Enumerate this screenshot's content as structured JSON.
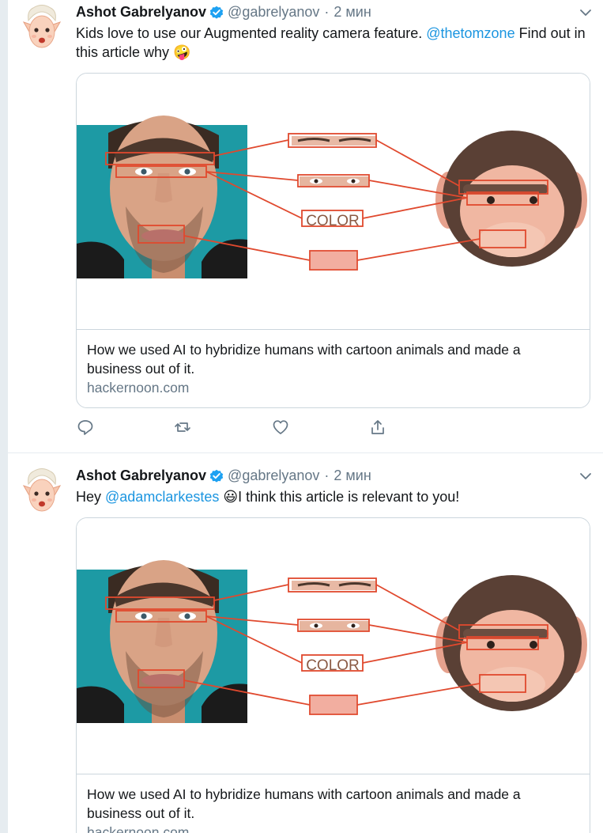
{
  "colors": {
    "link": "#1b95e0",
    "verified": "#1da1f2",
    "muted": "#657786",
    "annotation": "#e0492e"
  },
  "tweets": [
    {
      "avatar_icon": "elf-emoji-avatar-icon",
      "author": "Ashot Gabrelyanov",
      "verified": true,
      "handle": "@gabrelyanov",
      "separator": "·",
      "time": "2 мин",
      "text_before": "Kids love to use our Augmented reality camera feature. ",
      "mention": "@thetomzone",
      "text_after": " Find out in this article why",
      "emoji": "🤪",
      "card": {
        "image_label": "COLOR",
        "title": "How we used AI to hybridize humans with cartoon animals and made a business out of it.",
        "domain": "hackernoon.com"
      }
    },
    {
      "avatar_icon": "elf-emoji-avatar-icon",
      "author": "Ashot Gabrelyanov",
      "verified": true,
      "handle": "@gabrelyanov",
      "separator": "·",
      "time": "2 мин",
      "text_before": "Hey ",
      "mention": "@adamclarkestes",
      "emoji": "😃",
      "text_after": "I think this article is relevant to you!",
      "card": {
        "image_label": "COLOR",
        "title": "How we used AI to hybridize humans with cartoon animals and made a business out of it.",
        "domain": "hackernoon.com"
      }
    }
  ],
  "actions": [
    "reply-icon",
    "retweet-icon",
    "like-icon",
    "share-icon"
  ]
}
